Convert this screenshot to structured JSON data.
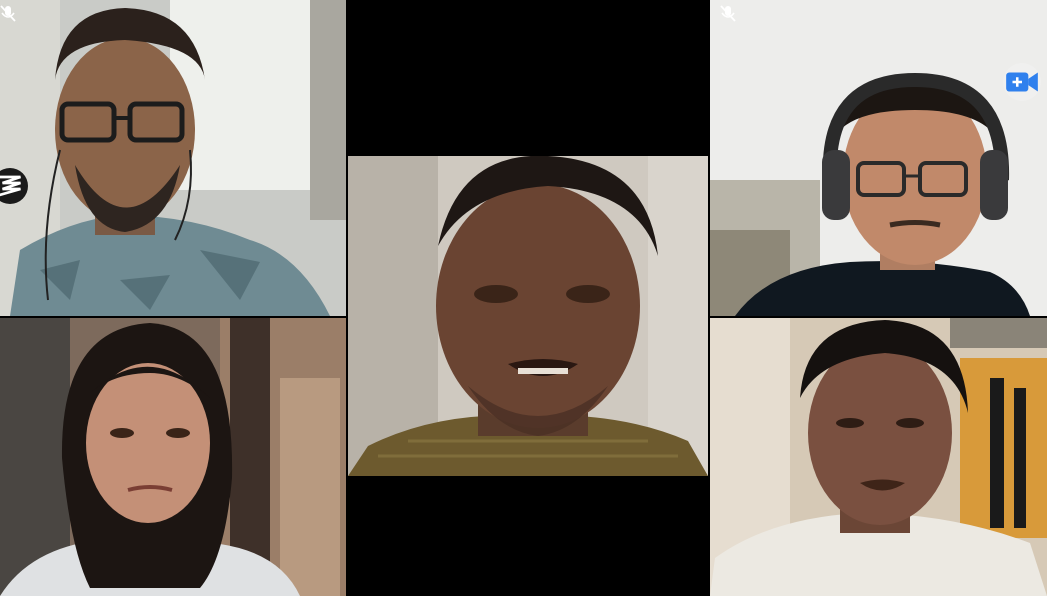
{
  "app": {
    "type": "video-call-grid"
  },
  "participants": [
    {
      "id": "p1",
      "position": "top-left",
      "muted": true,
      "video_on": true
    },
    {
      "id": "p2",
      "position": "center",
      "muted": false,
      "video_on": true,
      "active_speaker": true
    },
    {
      "id": "p3",
      "position": "top-right",
      "muted": true,
      "video_on": true
    },
    {
      "id": "p4",
      "position": "bottom-left",
      "muted": false,
      "video_on": true
    },
    {
      "id": "p5",
      "position": "bottom-right",
      "muted": false,
      "video_on": true
    }
  ],
  "icons": {
    "mute": "mic-off-icon",
    "camera": "camera-icon",
    "stack": "stacked-lines-icon"
  },
  "colors": {
    "background": "#000000",
    "camera_accent": "#2f80ed",
    "mute_icon": "#ffffff"
  }
}
